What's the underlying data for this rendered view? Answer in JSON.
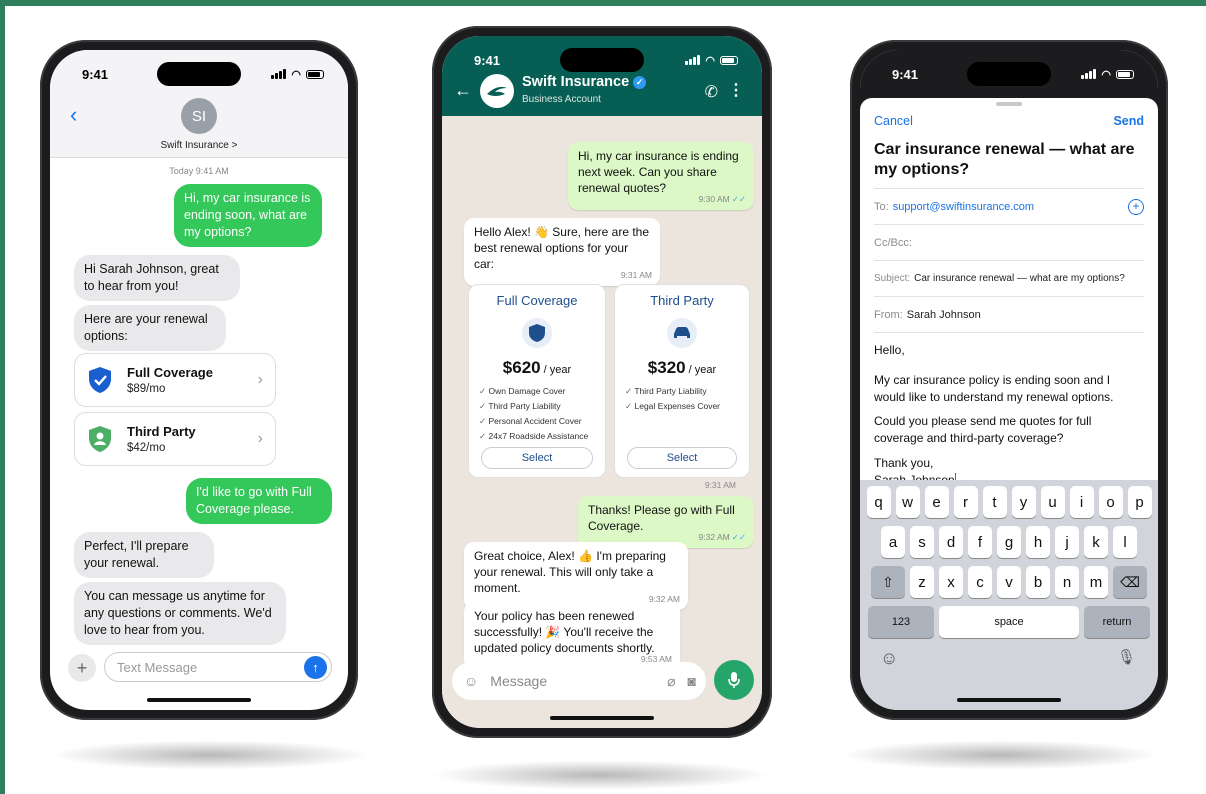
{
  "imessage": {
    "status_time": "9:41",
    "avatar_initials": "SI",
    "contact_name": "Swift Insurance >",
    "timestamp": "Today 9:41 AM",
    "msg1": "Hi, my car insurance is ending soon, what are my options?",
    "msg2": "Hi Sarah Johnson, great to hear from you!",
    "msg3": "Here are your renewal options:",
    "options": [
      {
        "title": "Full Coverage",
        "price": "$89/mo"
      },
      {
        "title": "Third Party",
        "price": "$42/mo"
      }
    ],
    "msg4": "I'd like to go with Full Coverage please.",
    "msg5": "Perfect, I'll prepare your renewal.",
    "msg6": "You can message us anytime for any questions or comments. We'd love to hear from you.",
    "input_placeholder": "Text Message"
  },
  "whatsapp": {
    "status_time": "9:41",
    "title": "Swift Insurance",
    "subtitle": "Business Account",
    "messages": [
      {
        "text": "Hi, my car insurance is ending next week. Can you share renewal quotes?",
        "time": "9:30 AM"
      },
      {
        "text": "Hello Alex! 👋 Sure, here are the best renewal options for your car:",
        "time": "9:31 AM"
      },
      {
        "text": "Thanks! Please go with Full Coverage.",
        "time": "9:32 AM"
      },
      {
        "text": "Great choice, Alex! 👍 I'm preparing your renewal. This will only take a moment.",
        "time": "9:32 AM"
      },
      {
        "text": "Your policy has been renewed successfully! 🎉 You'll receive the updated policy documents shortly.",
        "time": "9:53 AM"
      }
    ],
    "plans": [
      {
        "title": "Full Coverage",
        "price": "$620",
        "per": " / year",
        "features": [
          "Own Damage Cover",
          "Third Party Liability",
          "Personal Accident Cover",
          "24x7 Roadside Assistance"
        ],
        "button": "Select"
      },
      {
        "title": "Third Party",
        "price": "$320",
        "per": " / year",
        "features": [
          "Third Party Liability",
          "Legal Expenses Cover"
        ],
        "button": "Select"
      }
    ],
    "plans_time": "9:31 AM",
    "input_placeholder": "Message"
  },
  "mail": {
    "status_time": "9:41",
    "cancel": "Cancel",
    "send": "Send",
    "subject_title": "Car insurance renewal — what are my options?",
    "to_label": "To:",
    "to_value": "support@swiftinsurance.com",
    "ccbcc_label": "Cc/Bcc:",
    "subject_label": "Subject:",
    "subject_value": "Car insurance renewal — what are my options?",
    "from_label": "From:",
    "from_value": "Sarah Johnson",
    "body_greeting": "Hello,",
    "body_p1": "My car insurance policy is ending soon and I would like to understand my renewal options.",
    "body_p2": "Could you please send me quotes for full coverage and third-party coverage?",
    "body_signoff": "Thank you,",
    "body_name": "Sarah Johnson",
    "kb_row1": [
      "q",
      "w",
      "e",
      "r",
      "t",
      "y",
      "u",
      "i",
      "o",
      "p"
    ],
    "kb_row2": [
      "a",
      "s",
      "d",
      "f",
      "g",
      "h",
      "j",
      "k",
      "l"
    ],
    "kb_row3": [
      "z",
      "x",
      "c",
      "v",
      "b",
      "n",
      "m"
    ],
    "kb_123": "123",
    "kb_space": "space",
    "kb_return": "return"
  },
  "colors": {
    "brand_green": "#2e7d5b",
    "imessage_green": "#34c759",
    "whatsapp_header": "#075e54",
    "link_blue": "#1a73e8"
  }
}
